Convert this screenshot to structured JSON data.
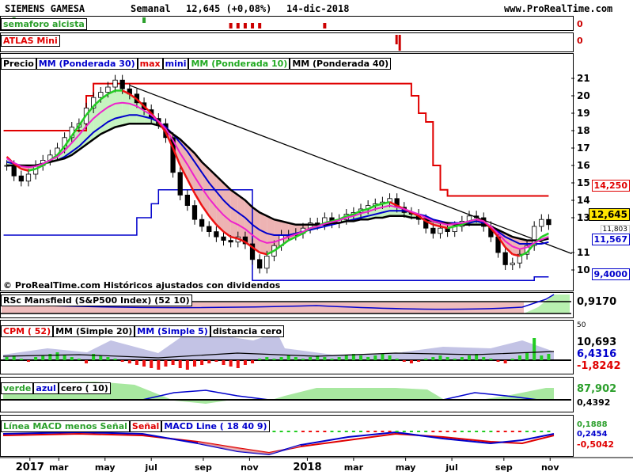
{
  "header": {
    "instrument": "SIEMENS GAMESA",
    "period": "Semanal",
    "quote": "12,645 (+0,08%)",
    "date": "14-dic-2018",
    "site": "www.ProRealTime.com"
  },
  "watermark": "© ProRealTime.com Históricos ajustados con dividendos",
  "panels": {
    "semaforo": {
      "label": "semaforo alcista",
      "value": "0"
    },
    "atlas": {
      "label": "ATLAS Mini",
      "value": "0"
    },
    "price": {
      "labels": [
        "Precio",
        "MM (Ponderada 30)",
        "max",
        "mini",
        "MM (Ponderada 10)",
        "MM (Ponderada 40)"
      ],
      "values": [
        "14,250",
        "12,645",
        "11,803",
        "11,567",
        "9,4000"
      ]
    },
    "rsc": {
      "label": "RSc Mansfield (S&P500 Index) (52 10)",
      "value": "0,9170"
    },
    "cpm": {
      "labels": [
        "CPM ( 52)",
        "MM (Simple 20)",
        "MM (Simple 5)",
        "distancia cero"
      ],
      "values": [
        "50",
        "10,693",
        "6,4316",
        "-1,8242"
      ]
    },
    "verde": {
      "labels": [
        "verde",
        "azul",
        "cero ( 10)"
      ],
      "values": [
        "87,902",
        "0,4392"
      ]
    },
    "macd": {
      "labels": [
        "Línea MACD menos Señal",
        "Señal",
        "MACD Line ( 18 40 9)"
      ],
      "values": [
        "0,1888",
        "0,2454",
        "-0,5042"
      ]
    }
  },
  "chart_data": {
    "type": "line",
    "title": "SIEMENS GAMESA Semanal 12,645 (+0,08%) 14-dic-2018",
    "x_axis_labels": [
      "2017",
      "mar",
      "may",
      "jul",
      "sep",
      "nov",
      "2018",
      "mar",
      "may",
      "jul",
      "sep",
      "nov"
    ],
    "ylim": [
      9.5,
      21.5
    ],
    "y_ticks": [
      10,
      11,
      13,
      14,
      15,
      16,
      17,
      18,
      19,
      20,
      21
    ],
    "close_weekly": [
      16.0,
      15.4,
      15.1,
      15.5,
      16.0,
      16.3,
      16.6,
      17.0,
      17.6,
      18.2,
      18.4,
      19.3,
      19.9,
      20.2,
      20.5,
      20.9,
      20.4,
      20.1,
      19.6,
      19.2,
      18.7,
      18.4,
      17.6,
      15.6,
      14.3,
      13.7,
      12.9,
      12.5,
      12.2,
      11.9,
      11.7,
      11.6,
      11.9,
      11.5,
      10.6,
      10.1,
      10.8,
      11.4,
      12.0,
      12.0,
      12.1,
      12.4,
      12.7,
      12.6,
      13.0,
      12.7,
      12.9,
      13.2,
      13.3,
      13.5,
      13.7,
      13.8,
      13.9,
      14.1,
      13.6,
      13.3,
      13.2,
      12.9,
      12.4,
      12.1,
      12.4,
      12.2,
      12.5,
      12.8,
      13.1,
      13.0,
      12.5,
      11.9,
      11.0,
      10.3,
      10.4,
      10.9,
      11.4,
      12.5,
      12.9,
      12.6
    ],
    "series": [
      {
        "name": "MM (Ponderada 10)",
        "values": [
          16.5,
          16.1,
          15.8,
          15.7,
          15.8,
          16.0,
          16.3,
          16.6,
          17.1,
          17.7,
          18.3,
          18.9,
          19.4,
          19.8,
          20.1,
          20.3,
          20.3,
          20.1,
          19.8,
          19.4,
          19.0,
          18.5,
          17.9,
          17.0,
          16.0,
          15.2,
          14.4,
          13.7,
          13.1,
          12.6,
          12.2,
          11.9,
          11.8,
          11.6,
          11.3,
          11.0,
          10.9,
          11.1,
          11.4,
          11.7,
          11.9,
          12.1,
          12.4,
          12.5,
          12.7,
          12.8,
          12.9,
          13.1,
          13.2,
          13.4,
          13.5,
          13.7,
          13.8,
          13.9,
          13.7,
          13.5,
          13.3,
          13.1,
          12.8,
          12.6,
          12.5,
          12.4,
          12.5,
          12.6,
          12.8,
          12.9,
          12.8,
          12.4,
          11.9,
          11.3,
          10.9,
          10.8,
          11.0,
          11.5,
          11.9,
          12.1
        ]
      },
      {
        "name": "MM (Ponderada 30)",
        "values": [
          16.2,
          16.1,
          16.0,
          16.0,
          16.0,
          16.1,
          16.2,
          16.3,
          16.5,
          16.8,
          17.1,
          17.5,
          17.9,
          18.2,
          18.5,
          18.7,
          18.8,
          18.9,
          18.9,
          18.8,
          18.7,
          18.5,
          18.2,
          17.8,
          17.3,
          16.8,
          16.2,
          15.6,
          15.0,
          14.5,
          14.0,
          13.6,
          13.3,
          13.0,
          12.6,
          12.3,
          12.1,
          12.0,
          12.0,
          12.0,
          12.1,
          12.2,
          12.3,
          12.4,
          12.5,
          12.6,
          12.7,
          12.8,
          12.9,
          13.0,
          13.1,
          13.2,
          13.3,
          13.4,
          13.4,
          13.4,
          13.3,
          13.2,
          13.1,
          12.9,
          12.8,
          12.7,
          12.7,
          12.7,
          12.7,
          12.8,
          12.7,
          12.5,
          12.2,
          11.9,
          11.7,
          11.5,
          11.5,
          11.5,
          11.5,
          11.6
        ]
      },
      {
        "name": "MM (Ponderada 40)",
        "values": [
          16.0,
          16.0,
          16.0,
          16.0,
          16.0,
          16.1,
          16.2,
          16.3,
          16.4,
          16.6,
          16.9,
          17.2,
          17.5,
          17.8,
          18.0,
          18.2,
          18.3,
          18.4,
          18.4,
          18.4,
          18.4,
          18.3,
          18.1,
          17.8,
          17.5,
          17.1,
          16.7,
          16.2,
          15.8,
          15.4,
          15.0,
          14.6,
          14.3,
          14.0,
          13.6,
          13.3,
          13.1,
          12.9,
          12.8,
          12.7,
          12.6,
          12.6,
          12.6,
          12.6,
          12.6,
          12.7,
          12.7,
          12.8,
          12.8,
          12.9,
          12.9,
          13.0,
          13.0,
          13.1,
          13.1,
          13.1,
          13.0,
          13.0,
          12.9,
          12.8,
          12.7,
          12.7,
          12.6,
          12.6,
          12.6,
          12.6,
          12.6,
          12.5,
          12.3,
          12.1,
          11.9,
          11.8,
          11.7,
          11.7,
          11.7,
          11.8
        ]
      },
      {
        "name": "max",
        "values": [
          18.0,
          18.0,
          18.0,
          18.0,
          18.0,
          18.0,
          18.0,
          18.0,
          18.0,
          18.0,
          18.0,
          20.0,
          20.7,
          20.7,
          20.7,
          20.7,
          20.7,
          20.7,
          20.7,
          20.7,
          20.7,
          20.7,
          20.7,
          20.7,
          20.7,
          20.7,
          20.7,
          20.7,
          20.7,
          20.7,
          20.7,
          20.7,
          20.7,
          20.7,
          20.7,
          20.7,
          20.7,
          20.7,
          20.7,
          20.7,
          20.7,
          20.7,
          20.7,
          20.7,
          20.7,
          20.7,
          20.7,
          20.7,
          20.7,
          20.7,
          20.7,
          20.7,
          20.7,
          20.7,
          20.7,
          20.7,
          20.0,
          19.0,
          18.5,
          16.0,
          14.6,
          14.25,
          14.25,
          14.25,
          14.25,
          14.25,
          14.25,
          14.25,
          14.25,
          14.25,
          14.25,
          14.25,
          14.25,
          14.25,
          14.25,
          14.25
        ]
      },
      {
        "name": "mini",
        "values": [
          12.0,
          12.0,
          12.0,
          12.0,
          12.0,
          12.0,
          12.0,
          12.0,
          12.0,
          12.0,
          12.0,
          12.0,
          12.0,
          12.0,
          12.0,
          12.0,
          12.0,
          12.0,
          13.0,
          13.0,
          13.8,
          14.6,
          14.6,
          14.6,
          14.6,
          14.6,
          14.6,
          14.6,
          14.6,
          14.6,
          14.6,
          14.6,
          14.6,
          14.6,
          9.4,
          9.4,
          9.4,
          9.4,
          9.4,
          9.4,
          9.4,
          9.4,
          9.4,
          9.4,
          9.4,
          9.4,
          9.4,
          9.4,
          9.4,
          9.4,
          9.4,
          9.4,
          9.4,
          9.4,
          9.4,
          9.4,
          9.4,
          9.4,
          9.4,
          9.4,
          9.4,
          9.4,
          9.4,
          9.4,
          9.4,
          9.4,
          9.4,
          9.4,
          9.4,
          9.4,
          9.4,
          9.4,
          9.4,
          9.6,
          9.6,
          9.6
        ]
      }
    ],
    "trendline": {
      "from": {
        "week": 17,
        "value": 20.6
      },
      "to": {
        "week": 76,
        "value": 11.3
      }
    },
    "grid": false,
    "legend": "top-left"
  }
}
